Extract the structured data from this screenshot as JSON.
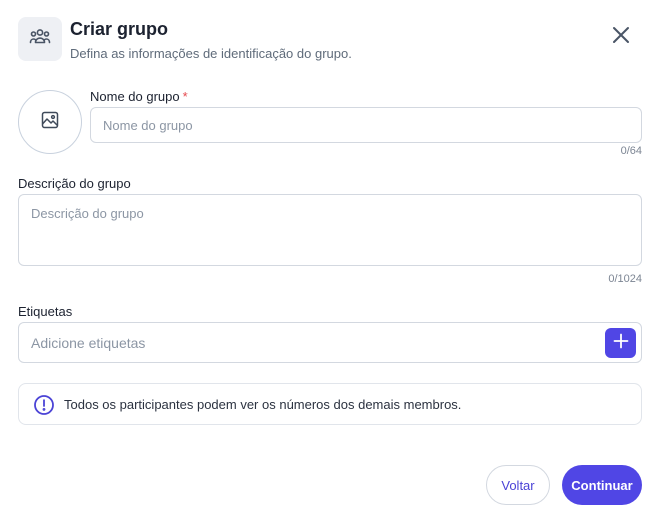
{
  "header": {
    "icon": "users-group-icon",
    "title": "Criar grupo",
    "subtitle": "Defina as informações de identificação do grupo.",
    "close_icon": "close-icon"
  },
  "avatar": {
    "icon": "image-icon"
  },
  "group_name": {
    "label": "Nome do grupo",
    "required_mark": "*",
    "value": "",
    "placeholder": "Nome do grupo",
    "counter": "0/64"
  },
  "description": {
    "label": "Descrição do grupo",
    "value": "",
    "placeholder": "Descrição do grupo",
    "counter": "0/1024"
  },
  "tags": {
    "label": "Etiquetas",
    "value": "",
    "placeholder": "Adicione etiquetas",
    "add_icon": "plus-icon"
  },
  "info": {
    "icon": "info-icon",
    "text": "Todos os participantes podem ver os números dos demais membros."
  },
  "footer": {
    "back_label": "Voltar",
    "continue_label": "Continuar"
  },
  "colors": {
    "accent": "#5046e5",
    "required": "#e5484d",
    "border": "#d3d8e0"
  }
}
